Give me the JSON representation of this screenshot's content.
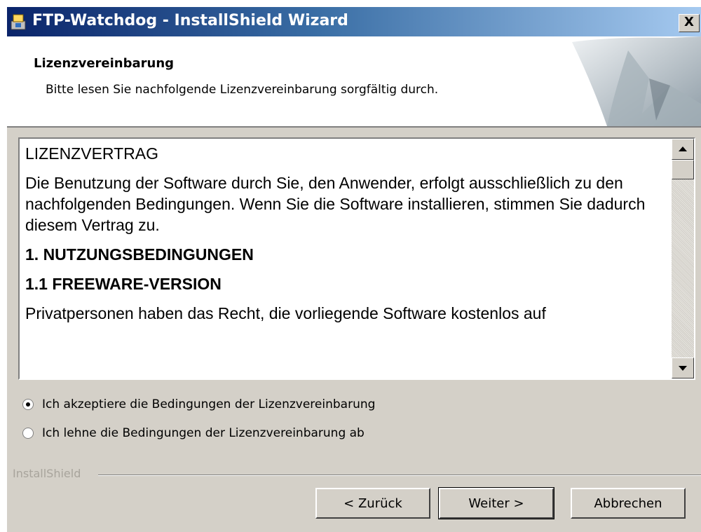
{
  "window": {
    "title": "FTP-Watchdog - InstallShield Wizard",
    "close_label": "X"
  },
  "header": {
    "title": "Lizenzvereinbarung",
    "subtitle": "Bitte lesen Sie nachfolgende Lizenzvereinbarung sorgfältig durch."
  },
  "license": {
    "heading": "LIZENZVERTRAG",
    "intro": "Die Benutzung der Software durch Sie, den Anwender, erfolgt ausschließlich zu den nachfolgenden Bedingungen. Wenn Sie die Software installieren, stimmen Sie dadurch diesem Vertrag zu.",
    "section1": "1. NUTZUNGSBEDINGUNGEN",
    "section11": "1.1 FREEWARE-VERSION",
    "partial": "Privatpersonen haben das Recht, die vorliegende Software kostenlos auf"
  },
  "options": {
    "accept": "Ich akzeptiere die Bedingungen der Lizenzvereinbarung",
    "decline": "Ich lehne die Bedingungen der Lizenzvereinbarung ab",
    "selected": "accept"
  },
  "footer": {
    "brand": "InstallShield",
    "back": "< Zurück",
    "next": "Weiter >",
    "cancel": "Abbrechen"
  }
}
